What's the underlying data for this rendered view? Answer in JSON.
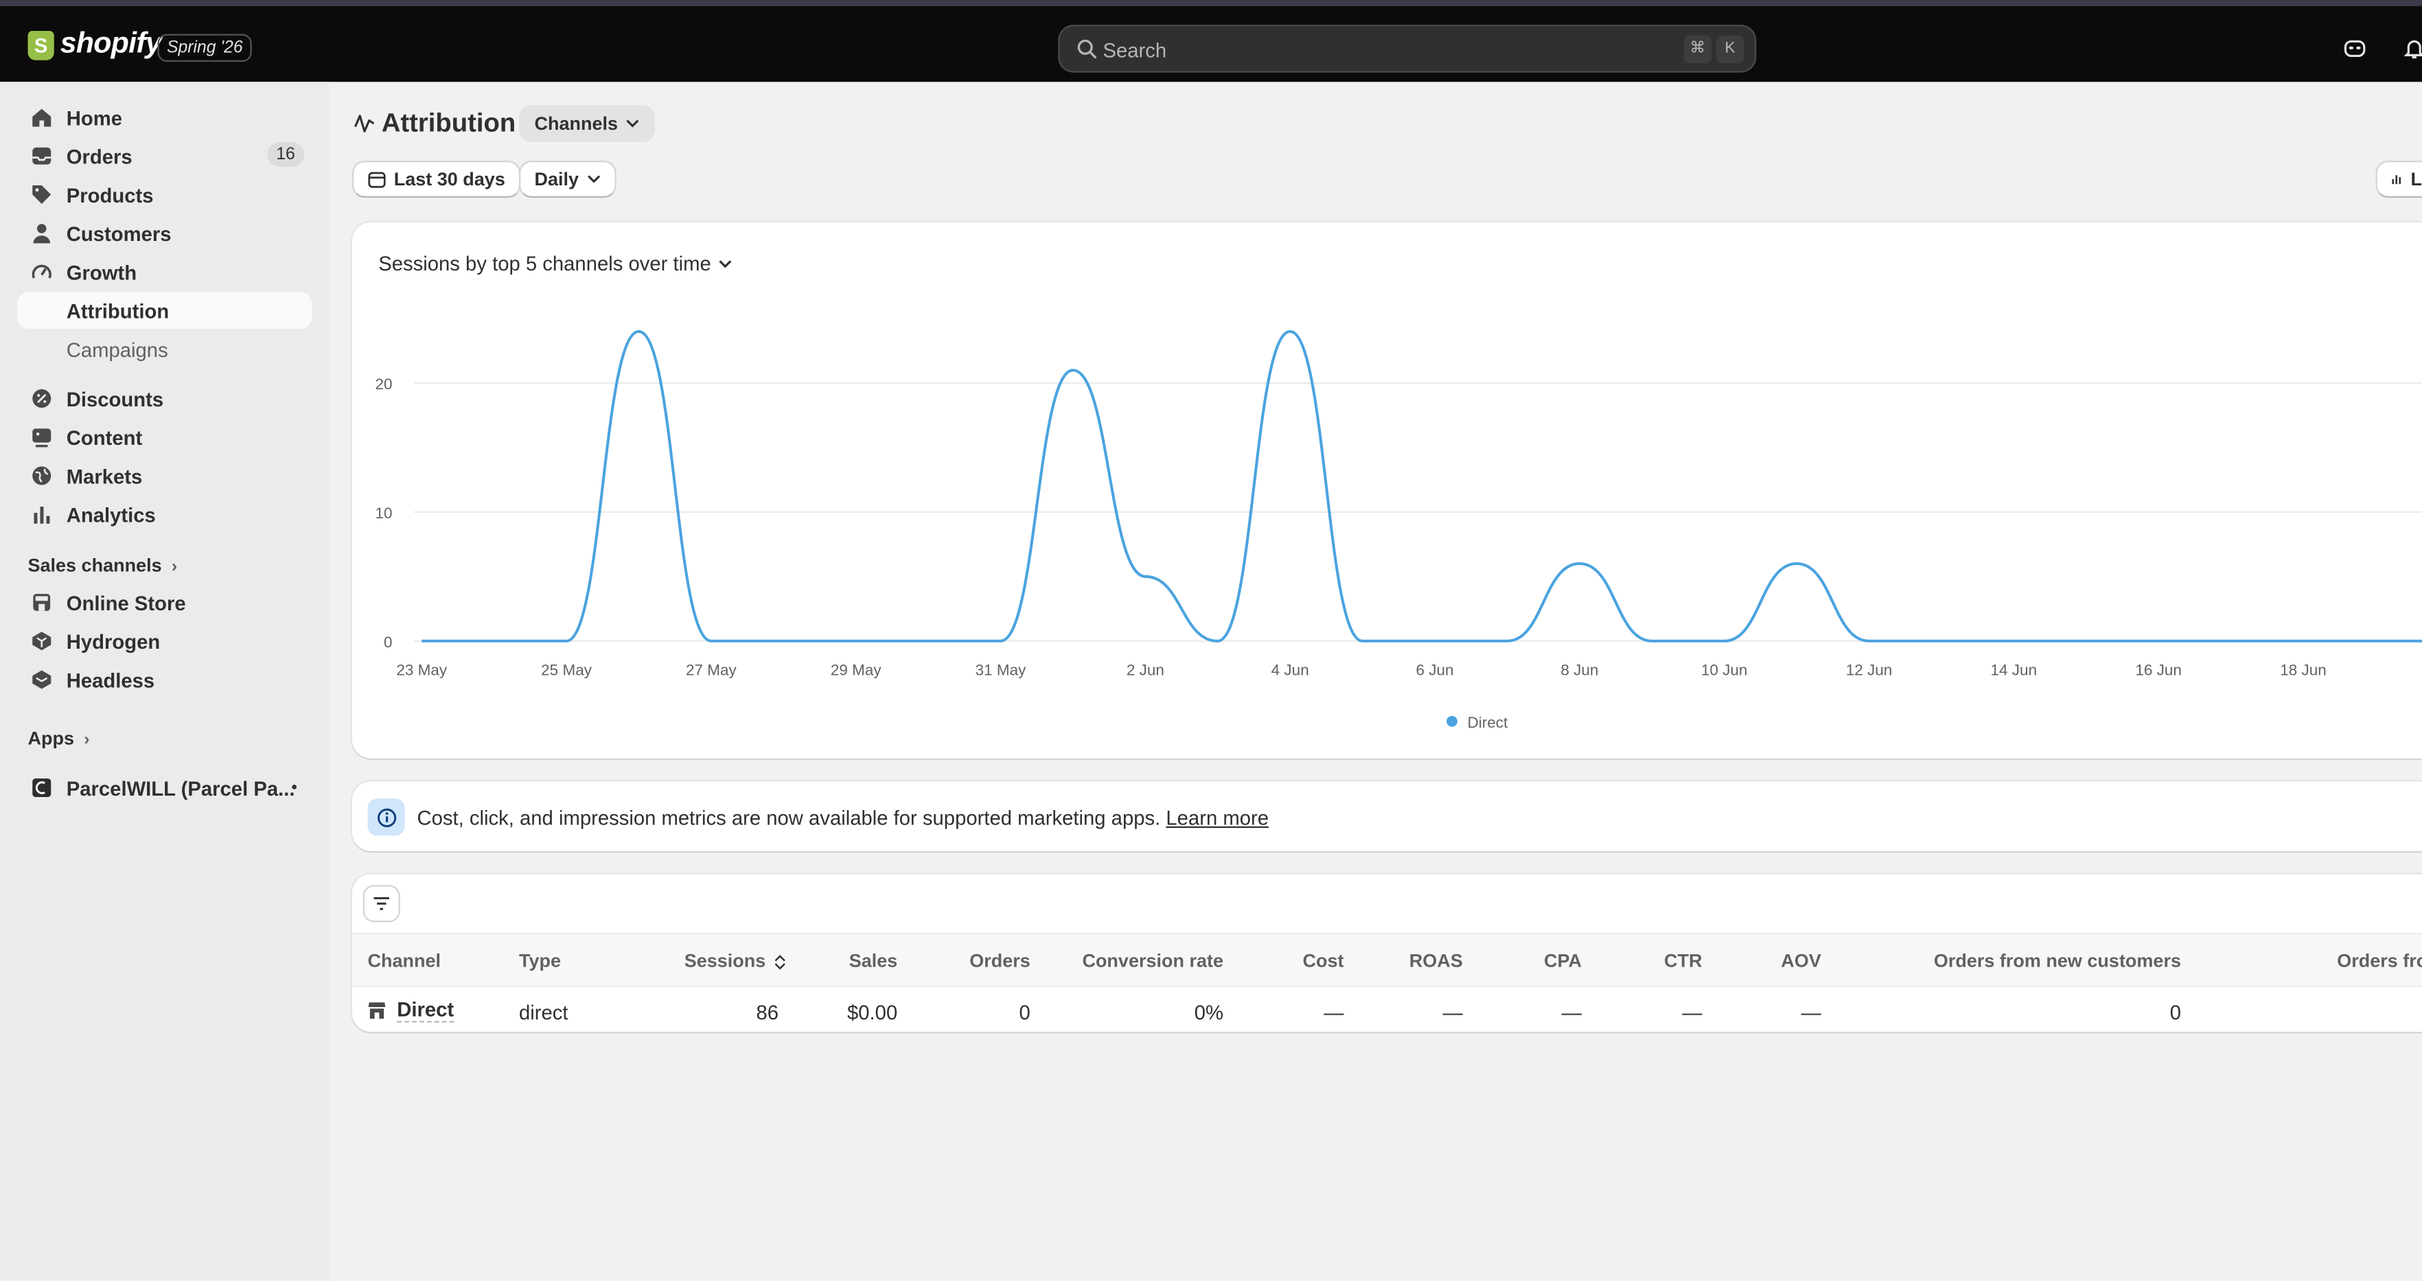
{
  "topbar": {
    "logo_mark": "S",
    "logo_text": "shopify",
    "edition_badge": "Spring '26",
    "search_placeholder": "Search",
    "shortcut_cmd": "⌘",
    "shortcut_key": "K"
  },
  "sidebar": {
    "items": [
      {
        "label": "Home"
      },
      {
        "label": "Orders",
        "badge": "16"
      },
      {
        "label": "Products"
      },
      {
        "label": "Customers"
      },
      {
        "label": "Growth"
      },
      {
        "label": "Attribution"
      },
      {
        "label": "Campaigns"
      },
      {
        "label": "Discounts"
      },
      {
        "label": "Content"
      },
      {
        "label": "Markets"
      },
      {
        "label": "Analytics"
      }
    ],
    "sales_channels_label": "Sales channels",
    "sales_channels": [
      {
        "label": "Online Store"
      },
      {
        "label": "Hydrogen"
      },
      {
        "label": "Headless"
      }
    ],
    "apps_label": "Apps",
    "apps": [
      {
        "label": "ParcelWILL (Parcel Pa..."
      }
    ]
  },
  "page": {
    "title": "Attribution",
    "view_selector": "Channels",
    "date_range": "Last 30 days",
    "granularity": "Daily",
    "partial_button": "L"
  },
  "chart_title": "Sessions by top 5 channels over time",
  "chart_data": {
    "type": "line",
    "x": [
      "23 May",
      "24 May",
      "25 May",
      "26 May",
      "27 May",
      "28 May",
      "29 May",
      "30 May",
      "31 May",
      "1 Jun",
      "2 Jun",
      "3 Jun",
      "4 Jun",
      "5 Jun",
      "6 Jun",
      "7 Jun",
      "8 Jun",
      "9 Jun",
      "10 Jun",
      "11 Jun",
      "12 Jun",
      "13 Jun",
      "14 Jun",
      "15 Jun",
      "16 Jun",
      "17 Jun",
      "18 Jun",
      "19 Jun",
      "20 Jun"
    ],
    "x_tick_labels": [
      "23 May",
      "25 May",
      "27 May",
      "29 May",
      "31 May",
      "2 Jun",
      "4 Jun",
      "6 Jun",
      "8 Jun",
      "10 Jun",
      "12 Jun",
      "14 Jun",
      "16 Jun",
      "18 Jun"
    ],
    "y_ticks": [
      "0",
      "10",
      "20"
    ],
    "ylim": [
      0,
      25
    ],
    "series": [
      {
        "name": "Direct",
        "color": "#4aa3df",
        "values": [
          0,
          0,
          0,
          24,
          0,
          0,
          0,
          0,
          0,
          21,
          5,
          0,
          24,
          0,
          0,
          0,
          6,
          0,
          0,
          6,
          0,
          0,
          0,
          0,
          0,
          0,
          0,
          0,
          0
        ]
      }
    ],
    "grid": true,
    "legend_position": "bottom"
  },
  "info_banner": {
    "text": "Cost, click, and impression metrics are now available for supported marketing apps.",
    "link": "Learn more"
  },
  "table": {
    "columns": [
      "Channel",
      "Type",
      "Sessions",
      "Sales",
      "Orders",
      "Conversion rate",
      "Cost",
      "ROAS",
      "CPA",
      "CTR",
      "AOV",
      "Orders from new customers",
      "Orders fro"
    ],
    "rows": [
      [
        "Direct",
        "direct",
        "86",
        "$0.00",
        "0",
        "0%",
        "—",
        "—",
        "—",
        "—",
        "—",
        "0",
        ""
      ]
    ]
  }
}
